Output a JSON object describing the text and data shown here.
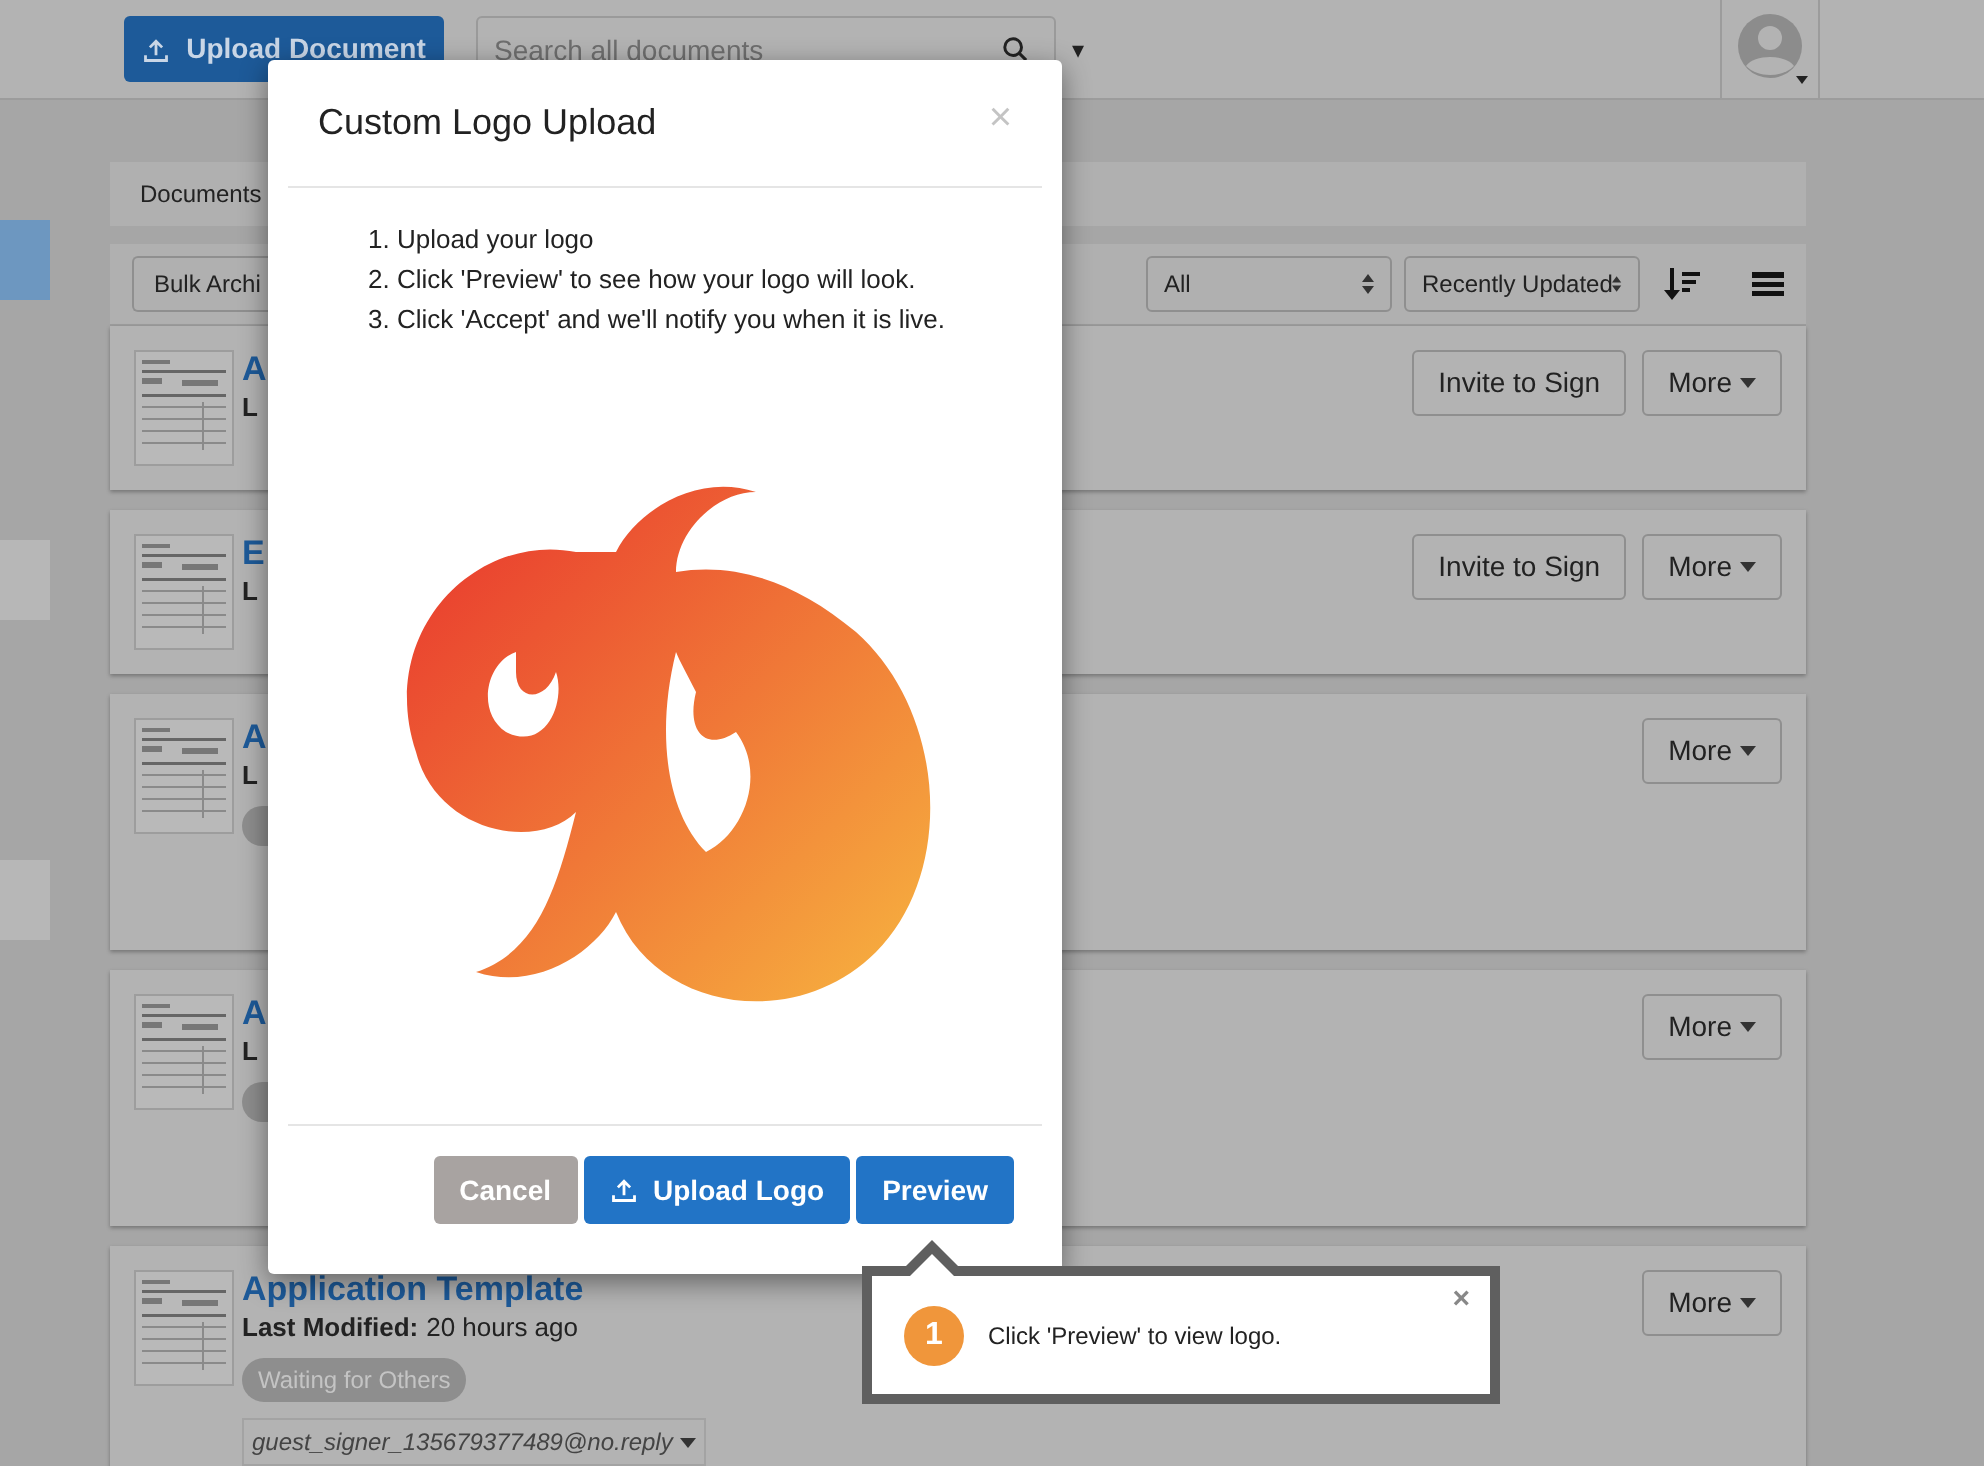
{
  "top_bar": {
    "upload_button": "Upload Document",
    "search": {
      "placeholder": "Search all documents"
    },
    "search_menu": "▾"
  },
  "sidebar": {
    "items": [
      {
        "selected": true
      },
      {
        "selected": false
      },
      {
        "selected": false
      }
    ]
  },
  "breadcrumb": "Documents",
  "toolbar": {
    "bulk_button": "Bulk Archi",
    "filter": "All",
    "sort": "Recently Updated"
  },
  "documents": [
    {
      "title": "A",
      "meta_label": "L",
      "actions": [
        "Invite to Sign",
        "More"
      ],
      "kind": "plain"
    },
    {
      "title": "E",
      "meta_label": "L",
      "actions": [
        "Invite to Sign",
        "More"
      ],
      "kind": "plain"
    },
    {
      "title": "A",
      "meta_label": "L",
      "actions": [
        "More"
      ],
      "kind": "tagged"
    },
    {
      "title": "A",
      "meta_label": "L",
      "actions": [
        "More"
      ],
      "kind": "tagged"
    },
    {
      "title": "Application Template",
      "meta_label": "Last Modified:",
      "meta_value": "20 hours ago",
      "status": "Waiting for Others",
      "signer": "guest_signer_135679377489@no.reply",
      "actions": [
        "More"
      ],
      "kind": "tagged"
    }
  ],
  "modal": {
    "title": "Custom Logo Upload",
    "close": "×",
    "steps": [
      {
        "number": "1.",
        "text": "Upload your logo"
      },
      {
        "number": "2.",
        "text": "Click 'Preview' to see how your logo will look."
      },
      {
        "number": "3.",
        "text": "Click 'Accept' and we'll notify you when it is live."
      }
    ],
    "buttons": [
      {
        "label": "Cancel",
        "kind": "cancel"
      },
      {
        "label": "Upload Logo",
        "kind": "upload"
      },
      {
        "label": "Preview",
        "kind": "primary"
      }
    ]
  },
  "tooltip": {
    "step": "1",
    "text": "Click 'Preview' to view logo.",
    "close": "×"
  }
}
